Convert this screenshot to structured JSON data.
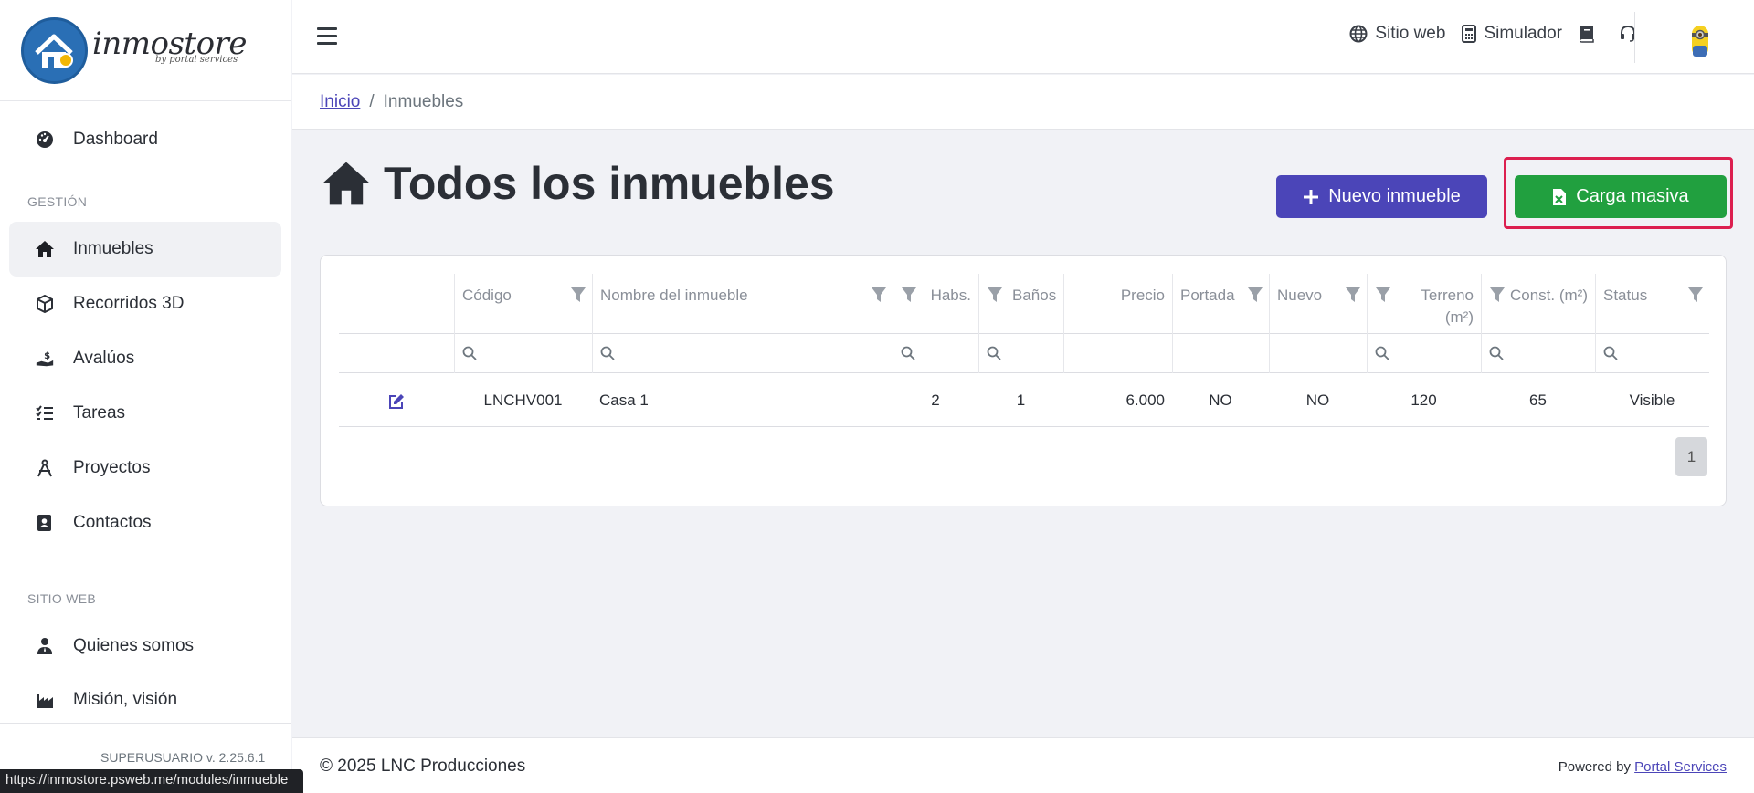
{
  "brand": {
    "name": "inmostore",
    "tagline": "by portal services"
  },
  "sidebar": {
    "items_top": [
      {
        "label": "Dashboard",
        "icon": "gauge-icon"
      }
    ],
    "section_gestion": "GESTIÓN",
    "items_gestion": [
      {
        "label": "Inmuebles",
        "icon": "home-icon",
        "active": true
      },
      {
        "label": "Recorridos 3D",
        "icon": "cube-icon"
      },
      {
        "label": "Avalúos",
        "icon": "hand-money-icon"
      },
      {
        "label": "Tareas",
        "icon": "list-check-icon"
      },
      {
        "label": "Proyectos",
        "icon": "compass-icon"
      },
      {
        "label": "Contactos",
        "icon": "address-book-icon"
      }
    ],
    "section_sitio": "SITIO WEB",
    "items_sitio": [
      {
        "label": "Quienes somos",
        "icon": "user-tie-icon"
      },
      {
        "label": "Misión, visión",
        "icon": "industry-icon"
      }
    ],
    "version": "SUPERUSUARIO v. 2.25.6.1"
  },
  "topbar": {
    "links": [
      {
        "label": "Sitio web",
        "icon": "globe-icon"
      },
      {
        "label": "Simulador",
        "icon": "calculator-icon"
      }
    ],
    "icons": [
      "book-icon",
      "headset-icon"
    ]
  },
  "breadcrumb": {
    "home": "Inicio",
    "current": "Inmuebles",
    "separator": "/"
  },
  "page": {
    "title": "Todos los inmuebles",
    "new_button": "Nuevo inmueble",
    "bulk_button": "Carga masiva"
  },
  "table": {
    "columns": [
      "Código",
      "Nombre del inmueble",
      "Habs.",
      "Baños",
      "Precio",
      "Portada",
      "Nuevo",
      "Terreno",
      "(m²)",
      "Const. (m²)",
      "Status"
    ],
    "rows": [
      {
        "code": "LNCHV001",
        "name": "Casa 1",
        "habs": "2",
        "banos": "1",
        "precio": "6.000",
        "portada": "NO",
        "nuevo": "NO",
        "terreno": "120",
        "const": "65",
        "status": "Visible"
      }
    ],
    "page": "1"
  },
  "footer": {
    "copyright": "© 2025 LNC Producciones",
    "powered_prefix": "Powered by",
    "powered_link": "Portal Services"
  },
  "statusbar": {
    "url": "https://inmostore.psweb.me/modules/inmueble"
  },
  "colors": {
    "primary": "#4b45b8",
    "success": "#21a03f",
    "highlight": "#dc1f4f"
  }
}
